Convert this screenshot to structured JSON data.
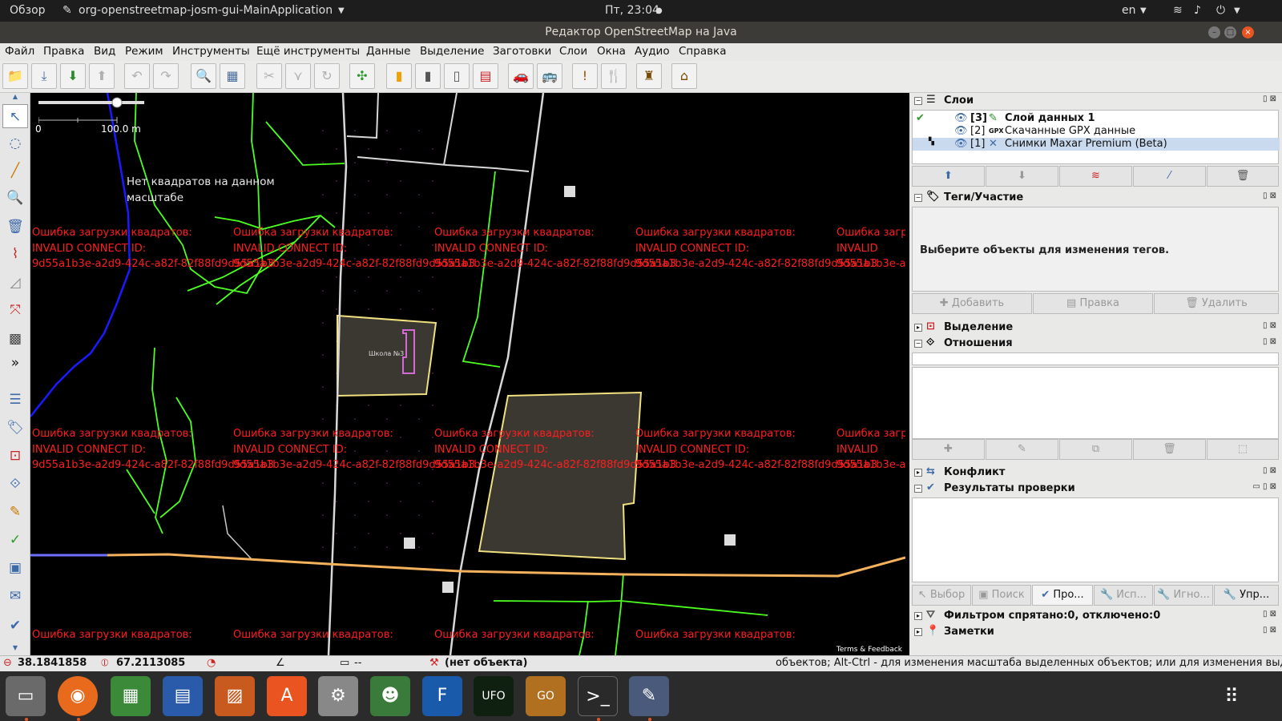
{
  "topbar": {
    "activities": "Обзор",
    "app": "org-openstreetmap-josm-gui-MainApplication",
    "clock": "Пт, 23:04",
    "lang": "en"
  },
  "window": {
    "title": "Редактор OpenStreetMap на Java"
  },
  "menu": [
    "Файл",
    "Правка",
    "Вид",
    "Режим",
    "Инструменты",
    "Ещё инструменты",
    "Данные",
    "Выделение",
    "Заготовки",
    "Слои",
    "Окна",
    "Аудио",
    "Справка"
  ],
  "map": {
    "scale_start": "0",
    "scale_end": "100.0 m",
    "no_squares": "Нет квадратов на данном масштабе",
    "error_l1": "Ошибка загрузки квадратов:",
    "error_l2": "INVALID CONNECT ID:",
    "error_l3": "9d55a1b3e-a2d9-424c-a82f-82f88fd9d55a1b3",
    "error_l2_short": "INVALID",
    "school": "Школа №3",
    "terms": "Terms & Feedback"
  },
  "panels": {
    "layers": {
      "title": "Слои",
      "items": [
        {
          "num": "[3]",
          "name": "Слой данных 1"
        },
        {
          "num": "[2]",
          "name": "Скачанные GPX данные",
          "badge": "GPX"
        },
        {
          "num": "[1]",
          "name": "Снимки Maxar Premium (Beta)"
        }
      ]
    },
    "tags": {
      "title": "Теги/Участие",
      "empty": "Выберите объекты для изменения тегов.",
      "add": "Добавить",
      "edit": "Правка",
      "delete": "Удалить"
    },
    "selection": {
      "title": "Выделение"
    },
    "relations": {
      "title": "Отношения"
    },
    "conflict": {
      "title": "Конфликт"
    },
    "validation": {
      "title": "Результаты проверки",
      "tabs": [
        "Выбор",
        "Поиск",
        "Про...",
        "Исп...",
        "Игно...",
        "Упр..."
      ]
    },
    "filter": {
      "title": "Фильтром спрятано:0, отключено:0"
    },
    "notes": {
      "title": "Заметки"
    }
  },
  "status": {
    "lat": "38.1841858",
    "lon": "67.2113085",
    "dist": "--",
    "object": "(нет объекта)",
    "hint": "объектов; Alt-Ctrl - для изменения масштаба выделенных объектов; или для изменения выделения"
  },
  "colors": {
    "accent": "#3d6aa8",
    "error": "#ff1e1e",
    "road": "#f5b25c",
    "path": "#4cff20"
  }
}
